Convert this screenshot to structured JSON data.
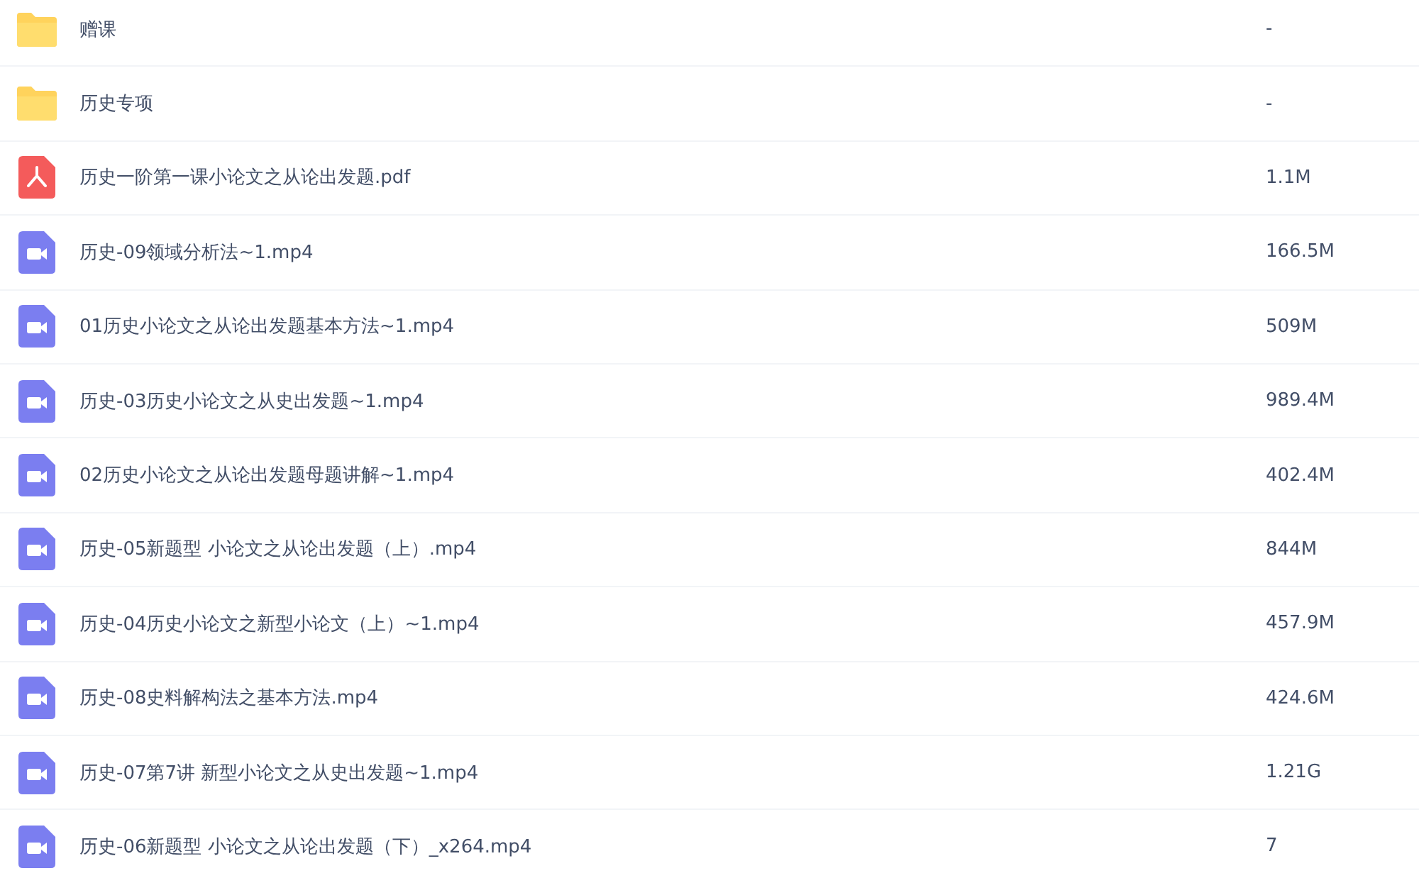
{
  "files": [
    {
      "kind": "folder",
      "name": "赠课",
      "size": "-"
    },
    {
      "kind": "folder",
      "name": "历史专项",
      "size": "-"
    },
    {
      "kind": "pdf",
      "name": "历史一阶第一课小论文之从论出发题.pdf",
      "size": "1.1M"
    },
    {
      "kind": "video",
      "name": "历史-09领域分析法~1.mp4",
      "size": "166.5M"
    },
    {
      "kind": "video",
      "name": "01历史小论文之从论出发题基本方法~1.mp4",
      "size": "509M"
    },
    {
      "kind": "video",
      "name": "历史-03历史小论文之从史出发题~1.mp4",
      "size": "989.4M"
    },
    {
      "kind": "video",
      "name": "02历史小论文之从论出发题母题讲解~1.mp4",
      "size": "402.4M"
    },
    {
      "kind": "video",
      "name": "历史-05新题型 小论文之从论出发题（上）.mp4",
      "size": "844M"
    },
    {
      "kind": "video",
      "name": "历史-04历史小论文之新型小论文（上）~1.mp4",
      "size": "457.9M"
    },
    {
      "kind": "video",
      "name": "历史-08史料解构法之基本方法.mp4",
      "size": "424.6M"
    },
    {
      "kind": "video",
      "name": "历史-07第7讲 新型小论文之从史出发题~1.mp4",
      "size": "1.21G"
    },
    {
      "kind": "video",
      "name": "历史-06新题型 小论文之从论出发题（下）_x264.mp4",
      "size": "7"
    }
  ]
}
